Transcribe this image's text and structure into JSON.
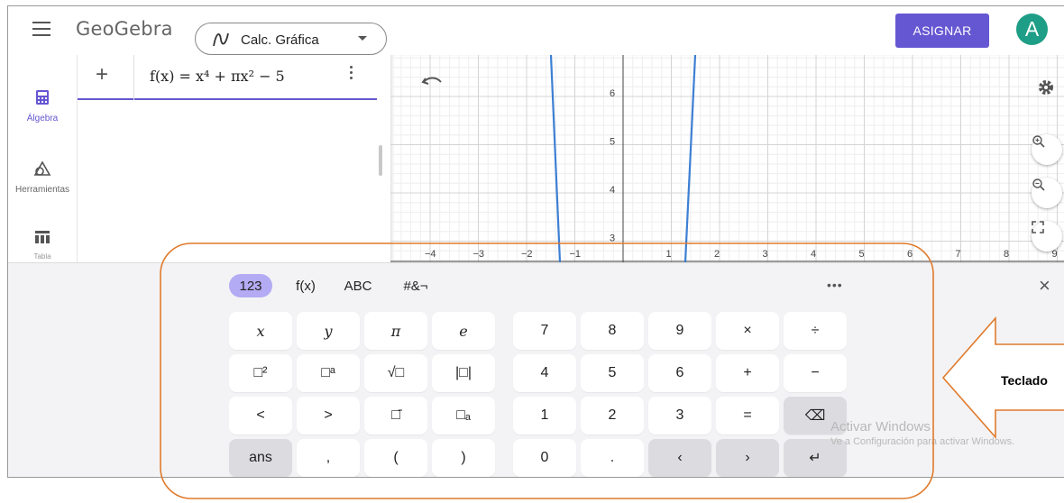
{
  "header": {
    "logo": "GeoGebra",
    "app_selector": "Calc. Gráfica",
    "assign_button": "ASIGNAR",
    "avatar_letter": "A"
  },
  "sidebar": {
    "items": [
      {
        "label": "Álgebra",
        "icon": "calculator-icon",
        "active": true
      },
      {
        "label": "Herramientas",
        "icon": "shapes-icon",
        "active": false
      },
      {
        "label": "Tabla",
        "icon": "table-icon",
        "active": false
      }
    ]
  },
  "algebra": {
    "plus": "+",
    "formula": "f(x) = x⁴ + πx² − 5"
  },
  "graphics": {
    "x_ticks": [
      "−4",
      "−3",
      "−2",
      "−1",
      "1",
      "2",
      "3",
      "4",
      "5",
      "6",
      "7",
      "8",
      "9"
    ],
    "y_ticks": [
      "6",
      "5",
      "4",
      "3"
    ],
    "curve_color": "#3d7fd3"
  },
  "keyboard": {
    "tabs": [
      "123",
      "f(x)",
      "ABC",
      "#&¬"
    ],
    "more": "•••",
    "close": "×",
    "left_keys": [
      [
        "x",
        "y",
        "π",
        "e"
      ],
      [
        "□²",
        "□ᵃ",
        "√□",
        "|□|"
      ],
      [
        "<",
        ">",
        "□̄",
        "□ₐ"
      ],
      [
        "ans",
        ",",
        "(",
        ")"
      ]
    ],
    "right_keys": [
      [
        "7",
        "8",
        "9",
        "×",
        "÷"
      ],
      [
        "4",
        "5",
        "6",
        "+",
        "−"
      ],
      [
        "1",
        "2",
        "3",
        "=",
        "⌫"
      ],
      [
        "0",
        ".",
        "‹",
        "›",
        "↵"
      ]
    ]
  },
  "watermark": {
    "title": "Activar Windows",
    "subtitle": "Ve a Configuración para activar Windows."
  },
  "annotation": {
    "label": "Teclado",
    "accent": "#e07a2c"
  }
}
